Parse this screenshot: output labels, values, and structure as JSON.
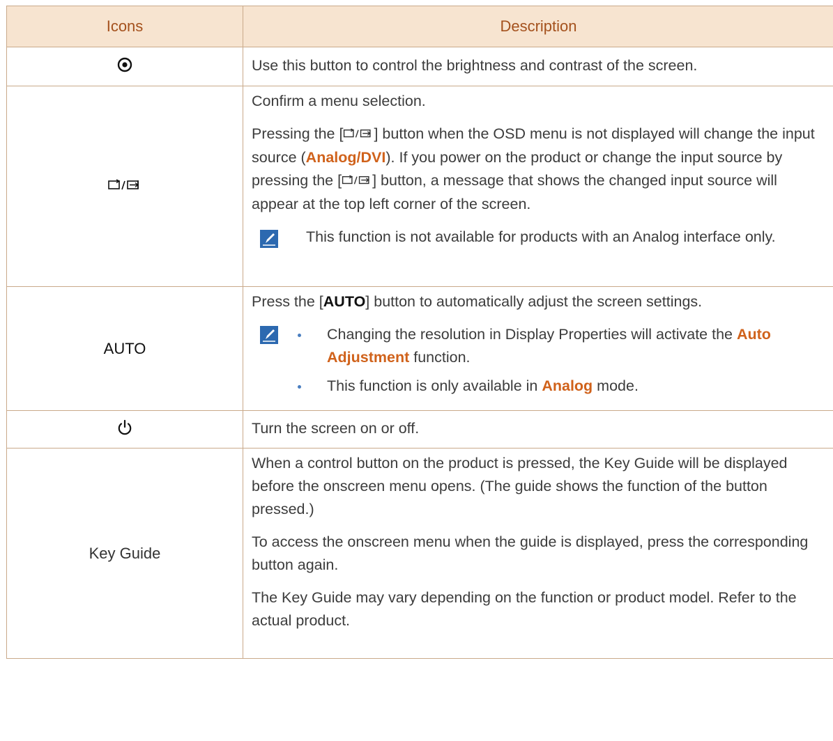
{
  "table": {
    "headers": {
      "icons": "Icons",
      "description": "Description"
    },
    "colors": {
      "header_bg": "#f7e4d0",
      "header_text": "#a4511d",
      "accent": "#d0621b",
      "border": "#c9a98a"
    },
    "rows": [
      {
        "icon": "brightness-contrast-icon",
        "description": "Use this button to control the brightness and contrast of the screen."
      },
      {
        "icon": "source-enter-icon",
        "p1": "Confirm a menu selection.",
        "p2_a": "Pressing the [",
        "p2_b": "] button when the OSD menu is not displayed will change the input source (",
        "p2_analog": "Analog",
        "p2_slash": "/",
        "p2_dvi": "DVI",
        "p2_c": "). If you power on the product or change the input source by pressing the [",
        "p2_d": "] button, a message that shows the changed input source will appear at the top left corner of the screen.",
        "note": "This function is not available for products with an Analog interface only."
      },
      {
        "icon_label": "AUTO",
        "p1_a": "Press the [",
        "p1_auto": "AUTO",
        "p1_b": "] button to automatically adjust the screen settings.",
        "bullet1_a": "Changing the resolution in Display Properties will activate the ",
        "bullet1_accent": "Auto Adjustment",
        "bullet1_b": " function.",
        "bullet2_a": "This function is only available in ",
        "bullet2_accent": "Analog",
        "bullet2_b": " mode."
      },
      {
        "icon": "power-icon",
        "description": "Turn the screen on or off."
      },
      {
        "icon_label": "Key Guide",
        "p1": "When a control button on the product is pressed, the Key Guide will be displayed before the onscreen menu opens. (The guide shows the function of the button pressed.)",
        "p2": "To access the onscreen menu when the guide is displayed, press the corresponding button again.",
        "p3": "The Key Guide may vary depending on the function or product model. Refer to the actual product."
      }
    ]
  }
}
